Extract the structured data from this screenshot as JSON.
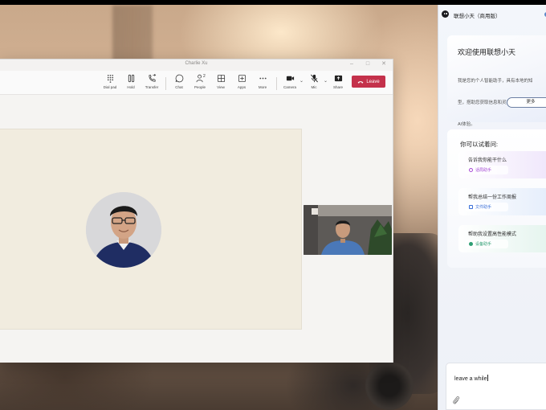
{
  "teams": {
    "window_title": "Charlie Xu",
    "toolbar": [
      {
        "id": "dialpad",
        "label": "Dial pad",
        "icon": "dialpad-icon"
      },
      {
        "id": "hold",
        "label": "Hold",
        "icon": "pause-icon"
      },
      {
        "id": "transfer",
        "label": "Transfer",
        "icon": "phone-transfer-icon"
      },
      {
        "id": "chat",
        "label": "Chat",
        "icon": "chat-icon"
      },
      {
        "id": "people",
        "label": "People",
        "icon": "people-icon",
        "count": "2"
      },
      {
        "id": "view",
        "label": "View",
        "icon": "grid-icon"
      },
      {
        "id": "apps",
        "label": "Apps",
        "icon": "plus-square-icon"
      },
      {
        "id": "more",
        "label": "More",
        "icon": "ellipsis-icon"
      },
      {
        "id": "camera",
        "label": "Camera",
        "icon": "camera-icon"
      },
      {
        "id": "mic",
        "label": "Mic",
        "icon": "mic-off-icon"
      },
      {
        "id": "share",
        "label": "Share",
        "icon": "share-icon"
      }
    ],
    "leave_label": "Leave",
    "colors": {
      "leave": "#c4314b",
      "stage": "#f1ecdf"
    }
  },
  "assistant": {
    "title": "联想小天（商用版）",
    "welcome_title": "欢迎使用联想小天",
    "welcome_lines": [
      "我是您的个人智能助手，具有本地的知",
      "型，搭助您获取信息和灵感，提供个性",
      "AI体验。"
    ],
    "more_label": "更多",
    "suggest_title": "你可以试着问:",
    "suggestions": [
      {
        "question": "告诉我你能干什么",
        "tag": "话局助手",
        "tag_color": "#a64bd6",
        "bg": "#efe6fb"
      },
      {
        "question": "帮我总结一份工作周报",
        "tag": "文件助手",
        "tag_color": "#3a6fd8",
        "bg": "#e4edfb"
      },
      {
        "question": "帮助我设置高性能模式",
        "tag": "设备助手",
        "tag_color": "#2f9e73",
        "bg": "#e4f4ee"
      }
    ],
    "input_value": "leave a while"
  }
}
